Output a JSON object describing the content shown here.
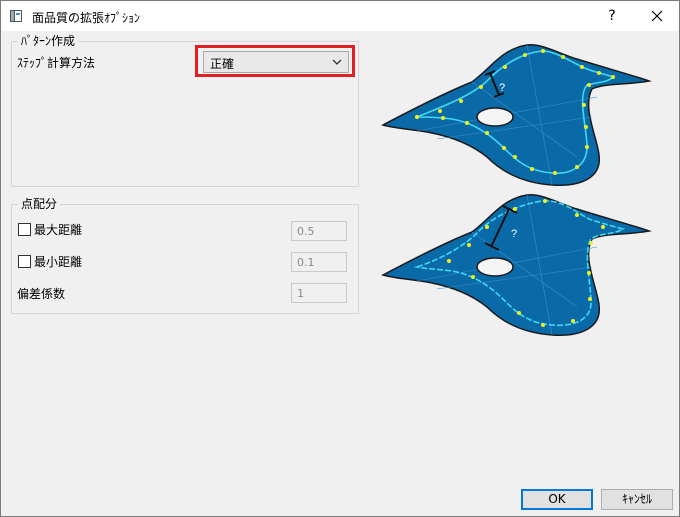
{
  "window": {
    "title": "面品質の拡張ｵﾌﾟｼｮﾝ",
    "help_glyph": "?",
    "icons": {
      "app": "dialog-app-icon",
      "close": "close-icon"
    }
  },
  "pattern_group": {
    "legend": "ﾊﾟﾀｰﾝ作成",
    "step_label": "ｽﾃｯﾌﾟ計算方法",
    "step_select": {
      "value": "正確"
    }
  },
  "point_group": {
    "legend": "点配分",
    "max_distance": {
      "label": "最大距離",
      "checked": false,
      "value": "0.5"
    },
    "min_distance": {
      "label": "最小距離",
      "checked": false,
      "value": "0.1"
    },
    "deviation": {
      "label": "偏差係数",
      "value": "1"
    }
  },
  "illustration": {
    "top_marker": "?",
    "bottom_marker": "?",
    "colors": {
      "surface": "#0a6aa8",
      "outline": "#1a1a1a",
      "curve": "#40d8f0",
      "points": "#f0f020"
    }
  },
  "buttons": {
    "ok": "OK",
    "cancel": "ｷｬﾝｾﾙ"
  }
}
